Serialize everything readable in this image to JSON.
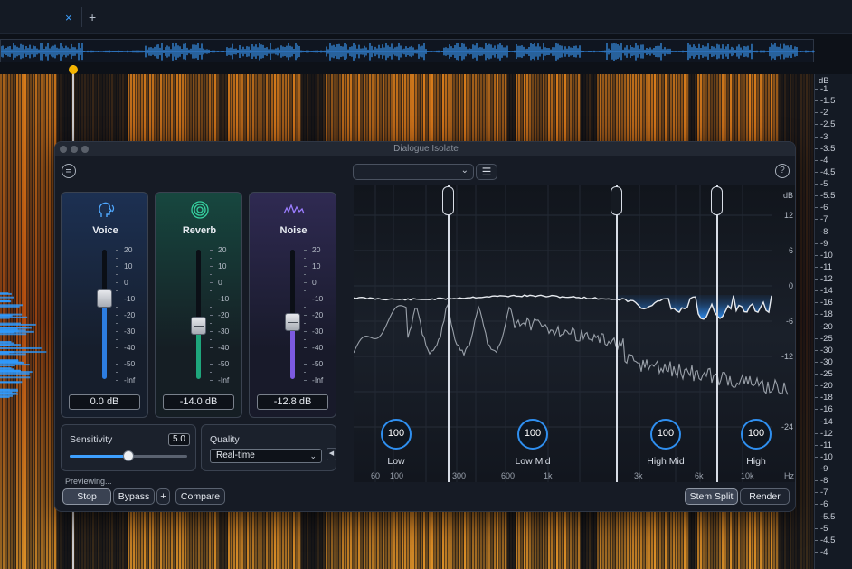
{
  "tabs": {
    "close_icon": "×",
    "add_icon": "+"
  },
  "ruler": {
    "unit": "dB",
    "labels": [
      "-1",
      "-1.5",
      "-2",
      "-2.5",
      "-3",
      "-3.5",
      "-4",
      "-4.5",
      "-5",
      "-5.5",
      "-6",
      "-7",
      "-8",
      "-9",
      "-10",
      "-11",
      "-12",
      "-14",
      "-16",
      "-18",
      "-20",
      "-25",
      "-30",
      "-30",
      "-25",
      "-20",
      "-18",
      "-16",
      "-14",
      "-12",
      "-11",
      "-10",
      "-9",
      "-8",
      "-7",
      "-6",
      "-5.5",
      "-5",
      "-4.5",
      "-4"
    ]
  },
  "plugin": {
    "title": "Dialogue Isolate",
    "preset_value": "",
    "menu_icon": "☰",
    "stems": [
      {
        "name": "Voice",
        "icon": "head-voice-icon",
        "value": "0.0 dB",
        "level": 0.62,
        "color": "#2d7de0"
      },
      {
        "name": "Reverb",
        "icon": "reverb-rings-icon",
        "value": "-14.0 dB",
        "level": 0.41,
        "color": "#1ea67c"
      },
      {
        "name": "Noise",
        "icon": "noise-wave-icon",
        "value": "-12.8 dB",
        "level": 0.44,
        "color": "#7c5ae0"
      }
    ],
    "fader_scale": [
      "20",
      "10",
      "0",
      "-10",
      "-20",
      "-30",
      "-40",
      "-50",
      "-Inf"
    ],
    "sensitivity": {
      "label": "Sensitivity",
      "value": "5.0",
      "level": 0.5
    },
    "quality": {
      "label": "Quality",
      "value": "Real-time"
    },
    "previewing": "Previewing...",
    "buttons": {
      "stop": "Stop",
      "bypass": "Bypass",
      "plus": "+",
      "compare": "Compare",
      "stem_split": "Stem Split",
      "render": "Render"
    },
    "eq": {
      "db_unit": "dB",
      "db_labels": [
        "12",
        "6",
        "0",
        "-6",
        "-12",
        "-24"
      ],
      "freq_unit": "Hz",
      "freq_labels": [
        "60",
        "100",
        "300",
        "600",
        "1k",
        "3k",
        "6k",
        "10k"
      ],
      "bands": [
        {
          "name": "Low",
          "value": "100"
        },
        {
          "name": "Low Mid",
          "value": "100"
        },
        {
          "name": "High Mid",
          "value": "100"
        },
        {
          "name": "High",
          "value": "100"
        }
      ]
    }
  }
}
